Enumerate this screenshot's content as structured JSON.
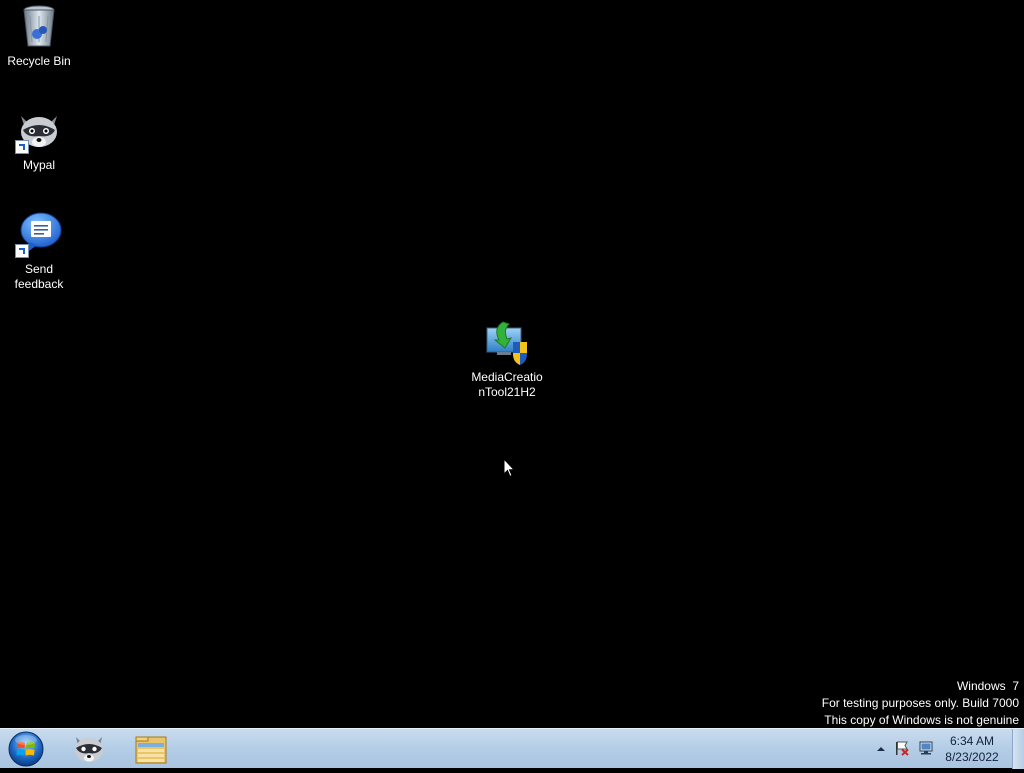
{
  "desktop": {
    "icons": [
      {
        "label": "Recycle Bin",
        "icon": "recycle-bin-icon"
      },
      {
        "label": "Mypal",
        "icon": "mypal-raccoon-icon"
      },
      {
        "label": "Send feedback",
        "icon": "feedback-speech-bubble-icon"
      },
      {
        "label": "MediaCreationTool21H2",
        "label_line1": "MediaCreatio",
        "label_line2": "nTool21H2",
        "icon": "media-creation-tool-icon"
      }
    ]
  },
  "watermark": {
    "line1": "Windows  7",
    "line2": "For testing purposes only. Build 7000",
    "line3": "This copy of Windows is not genuine"
  },
  "taskbar": {
    "start_icon": "windows-start-orb-icon",
    "pinned": [
      {
        "icon": "mypal-raccoon-icon"
      },
      {
        "icon": "folder-explorer-icon"
      }
    ],
    "tray": {
      "overflow_icon": "chevron-up-icon",
      "action_center_icon": "flag-icon",
      "network_icon": "network-icon",
      "time": "6:34 AM",
      "date": "8/23/2022"
    }
  },
  "colors": {
    "desktop_bg": "#000000",
    "taskbar_top": "#c9dcee",
    "taskbar_bottom": "#a9c4e0",
    "text_white": "#ffffff"
  }
}
